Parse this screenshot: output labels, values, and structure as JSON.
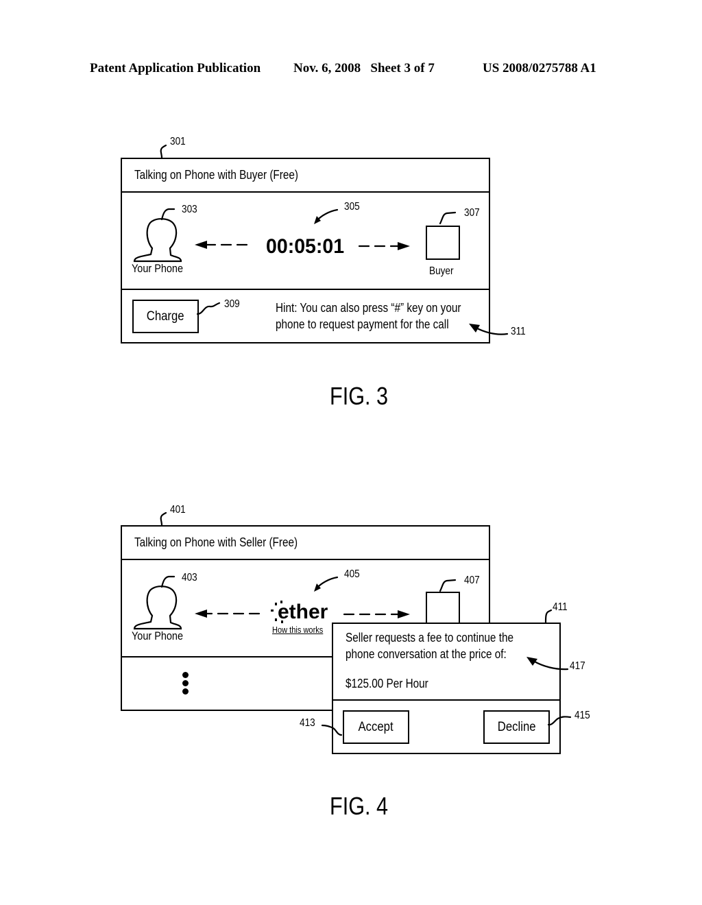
{
  "header": {
    "publication": "Patent Application Publication",
    "date_sheet": "Nov. 6, 2008   Sheet 3 of 7",
    "patent_number": "US 2008/0275788 A1"
  },
  "fig3": {
    "caption": "FIG. 3",
    "ref_window": "301",
    "title": "Talking on Phone with Buyer (Free)",
    "your_phone": {
      "label": "Your Phone",
      "ref": "303",
      "icon": "person-icon"
    },
    "timer": {
      "value": "00:05:01",
      "ref": "305"
    },
    "buyer": {
      "label": "Buyer",
      "ref": "307",
      "icon": "buyer-avatar-box"
    },
    "charge_button": {
      "label": "Charge",
      "ref": "309"
    },
    "hint": {
      "line1": "Hint: You can also press “#” key on your",
      "line2": "phone to request payment for the call",
      "ref": "311"
    }
  },
  "fig4": {
    "caption": "FIG. 4",
    "ref_window": "401",
    "title": "Talking on Phone with Seller (Free)",
    "your_phone": {
      "label": "Your Phone",
      "ref": "403",
      "icon": "person-icon"
    },
    "ether": {
      "logo": "ether",
      "link": "How this works",
      "ref": "405"
    },
    "seller": {
      "ref": "407",
      "icon": "seller-avatar-box"
    },
    "more_icon": "vertical-ellipsis-icon",
    "dialog": {
      "ref": "411",
      "message_line1": "Seller requests a fee to continue the",
      "message_line2": "phone conversation at the price of:",
      "price": "$125.00 Per Hour",
      "message_ref": "417",
      "accept_label": "Accept",
      "accept_ref": "413",
      "decline_label": "Decline",
      "decline_ref": "415"
    }
  }
}
